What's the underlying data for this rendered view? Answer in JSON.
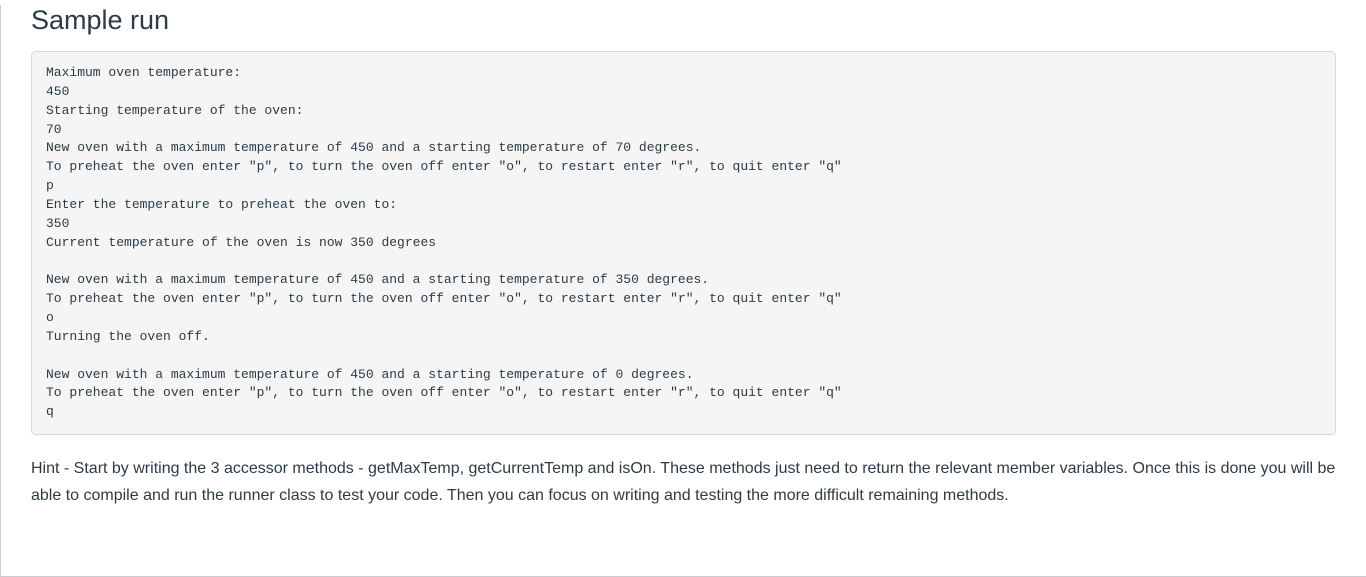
{
  "heading": "Sample run",
  "code_block": "Maximum oven temperature:\n450\nStarting temperature of the oven:\n70\nNew oven with a maximum temperature of 450 and a starting temperature of 70 degrees.\nTo preheat the oven enter \"p\", to turn the oven off enter \"o\", to restart enter \"r\", to quit enter \"q\"\np\nEnter the temperature to preheat the oven to:\n350\nCurrent temperature of the oven is now 350 degrees\n\nNew oven with a maximum temperature of 450 and a starting temperature of 350 degrees.\nTo preheat the oven enter \"p\", to turn the oven off enter \"o\", to restart enter \"r\", to quit enter \"q\"\no\nTurning the oven off.\n\nNew oven with a maximum temperature of 450 and a starting temperature of 0 degrees.\nTo preheat the oven enter \"p\", to turn the oven off enter \"o\", to restart enter \"r\", to quit enter \"q\"\nq",
  "hint_text": "Hint - Start by writing the 3 accessor methods - getMaxTemp, getCurrentTemp and isOn. These methods just need to return the relevant member variables. Once this is done you will be able to compile and run the runner class to test your code. Then you can focus on writing and testing the more difficult remaining methods."
}
